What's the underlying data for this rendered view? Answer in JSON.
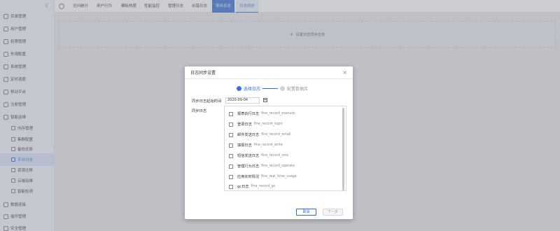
{
  "sidebar": {
    "items": [
      {
        "label": "目录管理"
      },
      {
        "label": "用户管理"
      },
      {
        "label": "权限管理"
      },
      {
        "label": "外观配置"
      },
      {
        "label": "系统管理"
      },
      {
        "label": "定时调度"
      },
      {
        "label": "移动平台"
      },
      {
        "label": "注册管理"
      },
      {
        "label": "智能运维"
      },
      {
        "label": "内存管理"
      },
      {
        "label": "集群配置"
      },
      {
        "label": "备份还原"
      },
      {
        "label": "平台日志"
      },
      {
        "label": "资源迁移"
      },
      {
        "label": "云端运维"
      },
      {
        "label": "智能检测"
      },
      {
        "label": "数据连接"
      },
      {
        "label": "插件管理"
      },
      {
        "label": "安全管理"
      }
    ]
  },
  "topbar": {
    "tabs": [
      {
        "label": "访问统计"
      },
      {
        "label": "用户行为"
      },
      {
        "label": "模板热度"
      },
      {
        "label": "性能监控"
      },
      {
        "label": "管理日志"
      },
      {
        "label": "出错日志"
      },
      {
        "label": "导出日志"
      },
      {
        "label": "日志同步"
      }
    ]
  },
  "content": {
    "add_task_label": "设置日志同步任务"
  },
  "modal": {
    "title": "日志同步设置",
    "close": "×",
    "steps": [
      {
        "label": "选择日志"
      },
      {
        "label": "配置数据库"
      }
    ],
    "start_time_label": "同步日志起始时间",
    "start_time_value": "2020-09-04",
    "logs_label": "同步日志",
    "logs": [
      {
        "cn": "报表执行日志",
        "en": "fine_record_execute"
      },
      {
        "cn": "登录日志",
        "en": "fine_record_login"
      },
      {
        "cn": "邮件发送日志",
        "en": "fine_record_email"
      },
      {
        "cn": "填报日志",
        "en": "fine_record_write"
      },
      {
        "cn": "短信发送日志",
        "en": "fine_record_sms"
      },
      {
        "cn": "管理行为日志",
        "en": "fine_record_operate"
      },
      {
        "cn": "应用实时情况",
        "en": "fine_real_time_usage"
      },
      {
        "cn": "gc日志",
        "en": "fine_record_gc"
      }
    ],
    "cancel_label": "取消",
    "next_label": "下一步"
  },
  "colors": {
    "accent": "#2f6bd6",
    "sidebar_active_bg": "#d9e6fb"
  }
}
